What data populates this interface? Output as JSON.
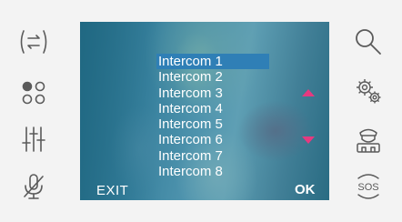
{
  "screen": {
    "menu_items": [
      "Intercom 1",
      "Intercom 2",
      "Intercom 3",
      "Intercom 4",
      "Intercom 5",
      "Intercom 6",
      "Intercom 7",
      "Intercom 8"
    ],
    "selected_item": "Intercom 1",
    "exit_label": "EXIT",
    "ok_label": "OK"
  },
  "left_icons": [
    "swap-arrows-icon",
    "dots-grid-icon",
    "sliders-icon",
    "mic-muted-icon"
  ],
  "right_icons": [
    "search-icon",
    "settings-gears-icon",
    "concierge-icon",
    "sos-icon"
  ],
  "right_icon_labels": {
    "sos": "SOS"
  },
  "colors": {
    "accent_pink": "#e6397f",
    "highlight_blue": "#2f7fb6",
    "icon_stroke": "#5a5a5a"
  }
}
